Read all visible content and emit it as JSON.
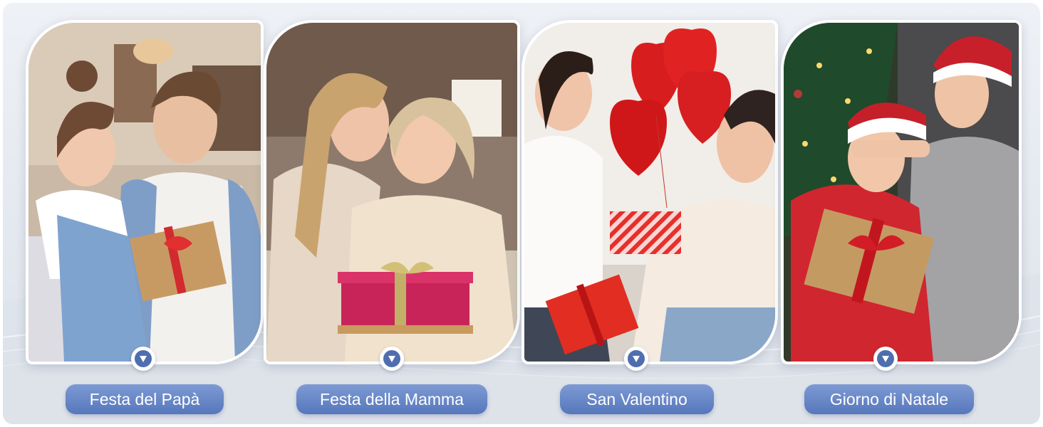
{
  "colors": {
    "background": "#e8ebf1",
    "label_bg": "#6584c6",
    "pin": "#4f6eb0",
    "label_text": "#ffffff"
  },
  "pin_icon": "chevron-down-icon",
  "occasions": [
    {
      "label": "Festa del Papà",
      "scene": "father hugging daughter with gift box"
    },
    {
      "label": "Festa della Mamma",
      "scene": "daughter kissing mother holding pink gift box"
    },
    {
      "label": "San Valentino",
      "scene": "couple exchanging red gift boxes with heart balloons"
    },
    {
      "label": "Giorno di Natale",
      "scene": "man covering woman's eyes with christmas gift"
    }
  ]
}
